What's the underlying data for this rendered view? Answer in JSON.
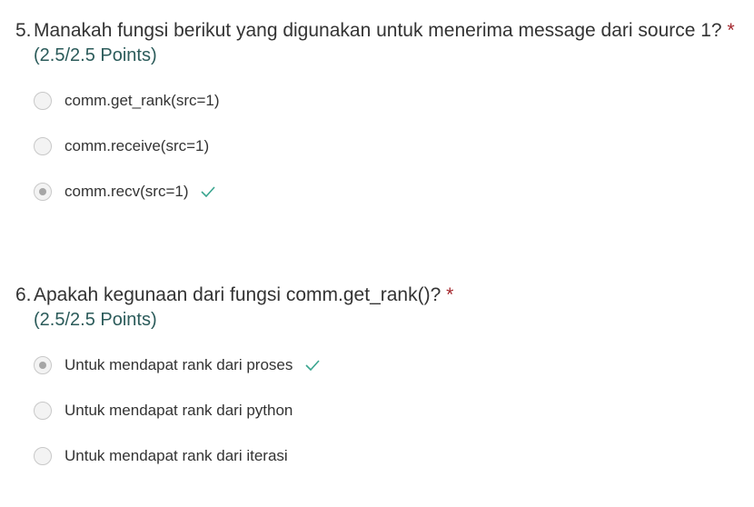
{
  "questions": [
    {
      "number": "5.",
      "text": "Manakah fungsi berikut yang digunakan untuk menerima message dari source 1?",
      "required_mark": "*",
      "points": "(2.5/2.5 Points)",
      "options": [
        {
          "label": "comm.get_rank(src=1)",
          "selected": false,
          "correct": false
        },
        {
          "label": "comm.receive(src=1)",
          "selected": false,
          "correct": false
        },
        {
          "label": "comm.recv(src=1)",
          "selected": true,
          "correct": true
        }
      ]
    },
    {
      "number": "6.",
      "text": "Apakah kegunaan dari fungsi comm.get_rank()?",
      "required_mark": "*",
      "points": "(2.5/2.5 Points)",
      "options": [
        {
          "label": "Untuk mendapat rank dari proses",
          "selected": true,
          "correct": true
        },
        {
          "label": "Untuk mendapat rank dari python",
          "selected": false,
          "correct": false
        },
        {
          "label": "Untuk mendapat rank dari iterasi",
          "selected": false,
          "correct": false
        }
      ]
    }
  ],
  "colors": {
    "required": "#a4262c",
    "points": "#2b5b5a",
    "check": "#3aa58f"
  }
}
